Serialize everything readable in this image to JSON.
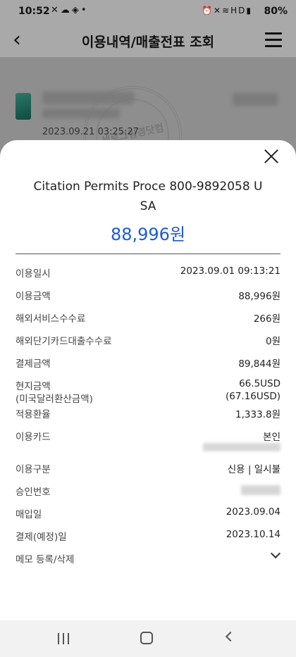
{
  "status_bar": {
    "time": "10:52",
    "battery": "80%",
    "left_icons": [
      "nfc-icon",
      "cloud-icon",
      "shield-app-icon",
      "dot-icon"
    ],
    "right_icons": [
      "alarm-icon",
      "mute-icon",
      "wifi-icon",
      "volte-icon",
      "signal-icon"
    ],
    "hd_label": "HD"
  },
  "app_bar": {
    "title": "이용내역/매출전표 조회",
    "back_icon": "chevron-left-icon",
    "menu_icon": "hamburger-menu-icon"
  },
  "background": {
    "date": "2023.09.21 03:25:27",
    "stamp_text": "세로그림경닷컴"
  },
  "sheet": {
    "merchant_line1": "Citation Permits Proce 800-9892058 U",
    "merchant_line2": "SA",
    "amount": "88,996원",
    "accent_color": "#1c5bd6",
    "rows": {
      "use_datetime": {
        "label": "이용일시",
        "value": "2023.09.01 09:13:21"
      },
      "use_amount": {
        "label": "이용금액",
        "value": "88,996원"
      },
      "overseas_fee": {
        "label": "해외서비스수수료",
        "value": "266원"
      },
      "overseas_cash_fee": {
        "label": "해외단기카드대출수수료",
        "value": "0원"
      },
      "payment_amount": {
        "label": "결제금액",
        "value": "89,844원"
      },
      "local_amount": {
        "label": "현지금액",
        "label_sub": "(미국달러환산금액)",
        "value": "66.5USD",
        "value_sub": "(67.16USD)"
      },
      "exchange_rate": {
        "label": "적용환율",
        "value": "1,333.8원"
      },
      "use_card": {
        "label": "이용카드",
        "value": "본인"
      },
      "use_type": {
        "label": "이용구분",
        "value": "신용 | 일시불"
      },
      "approval_no": {
        "label": "승인번호"
      },
      "purchase_date": {
        "label": "매입일",
        "value": "2023.09.04"
      },
      "pay_date": {
        "label": "결제(예정)일",
        "value": "2023.10.14"
      },
      "memo": {
        "label": "메모 등록/삭제"
      }
    }
  },
  "nav_bar": {
    "recent_icon": "recent-apps-icon",
    "home_icon": "home-icon",
    "back_icon": "back-icon"
  }
}
